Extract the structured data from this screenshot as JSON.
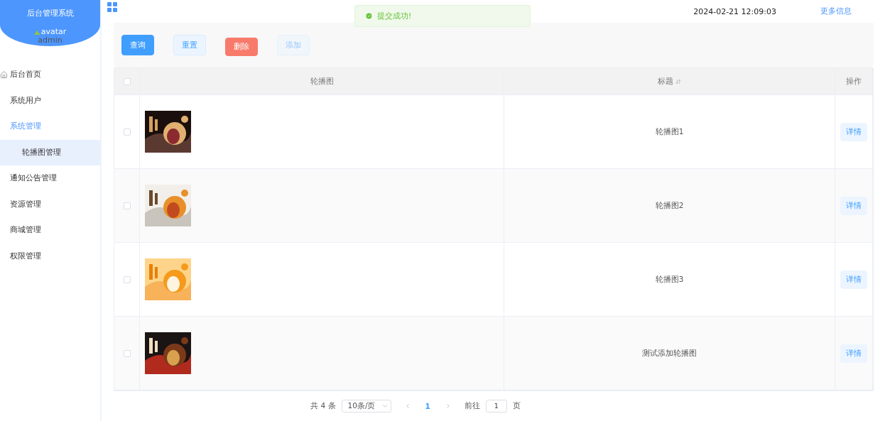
{
  "sidebar": {
    "title": "后台管理系统",
    "avatar_alt": "avatar",
    "username": "admin",
    "menu": [
      {
        "label": "后台首页",
        "kind": "home",
        "selected": false,
        "expanded": false
      },
      {
        "label": "系统用户",
        "kind": "item",
        "selected": false,
        "expanded": false
      },
      {
        "label": "系统管理",
        "kind": "group",
        "selected": false,
        "expanded": true,
        "children": [
          {
            "label": "轮播图管理",
            "selected": true
          }
        ]
      },
      {
        "label": "通知公告管理",
        "kind": "item",
        "selected": false,
        "expanded": false
      },
      {
        "label": "资源管理",
        "kind": "item",
        "selected": false,
        "expanded": false
      },
      {
        "label": "商城管理",
        "kind": "item",
        "selected": false,
        "expanded": false
      },
      {
        "label": "权限管理",
        "kind": "item",
        "selected": false,
        "expanded": false
      }
    ]
  },
  "header": {
    "datetime": "2024-02-21 12:09:03",
    "more_link": "更多信息"
  },
  "toast": {
    "message": "提交成功!"
  },
  "toolbar": {
    "buttons": [
      {
        "label": "查询",
        "kind": "primary",
        "disabled": false
      },
      {
        "label": "重置",
        "kind": "plain",
        "disabled": false
      },
      {
        "label": "删除",
        "kind": "danger",
        "disabled": false
      },
      {
        "label": "添加",
        "kind": "plain",
        "disabled": true
      }
    ]
  },
  "table": {
    "select_all": {
      "checked": false
    },
    "columns": [
      {
        "label": "轮播图",
        "sortable": false
      },
      {
        "label": "标题",
        "sortable": true
      },
      {
        "label": "操作",
        "sortable": false
      }
    ],
    "rows": [
      {
        "checked": false,
        "title": "轮播图1",
        "action": "详情"
      },
      {
        "checked": false,
        "title": "轮播图2",
        "action": "详情"
      },
      {
        "checked": false,
        "title": "轮播图3",
        "action": "详情"
      },
      {
        "checked": false,
        "title": "测试添加轮播图",
        "action": "详情"
      }
    ]
  },
  "pagination": {
    "total": "共 4 条",
    "page_size": "10条/页",
    "pages": [
      {
        "label": "1",
        "selected": true
      }
    ],
    "jump_label": "前往",
    "jump_value": "1",
    "jump_suffix": "页"
  }
}
